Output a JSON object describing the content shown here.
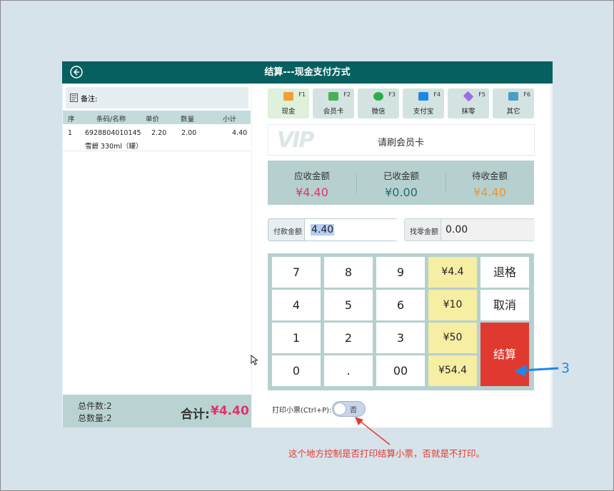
{
  "window": {
    "title": "结算---现金支付方式"
  },
  "left": {
    "memo_label": "备注:",
    "columns": [
      "序",
      "条码/名称",
      "单价",
      "数量",
      "小计"
    ],
    "items": [
      {
        "index": "1",
        "barcode": "6928804010145",
        "name": "雪碧 330ml（罐）",
        "price": "2.20",
        "qty": "2.00",
        "subtotal": "4.40"
      }
    ],
    "total_pieces": "总件数:2",
    "total_qty": "总数量:2",
    "total_label": "合计:",
    "total_value": "¥4.40"
  },
  "pay_methods": [
    {
      "label": "现金",
      "key": "F1",
      "icon": "cash-icon",
      "color": "#f29d38"
    },
    {
      "label": "会员卡",
      "key": "F2",
      "icon": "member-card-icon",
      "color": "#48b05a"
    },
    {
      "label": "微信",
      "key": "F3",
      "icon": "wechat-icon",
      "color": "#2aae4a"
    },
    {
      "label": "支付宝",
      "key": "F4",
      "icon": "alipay-icon",
      "color": "#1e88e5"
    },
    {
      "label": "抹零",
      "key": "F5",
      "icon": "diamond-icon",
      "color": "#9b6fe0"
    },
    {
      "label": "其它",
      "key": "F6",
      "icon": "cube-icon",
      "color": "#4a9fc4"
    }
  ],
  "vip": {
    "logo": "VIP",
    "prompt": "请刷会员卡"
  },
  "amounts": [
    {
      "label": "应收金额",
      "value": "¥4.40",
      "color": "#e0346b"
    },
    {
      "label": "已收金额",
      "value": "¥0.00",
      "color": "#1f6f6a"
    },
    {
      "label": "待收金额",
      "value": "¥4.40",
      "color": "#f0952b"
    }
  ],
  "payment": {
    "label": "付款金额",
    "value": "4.40"
  },
  "change": {
    "label": "找零金额",
    "value": "0.00"
  },
  "keypad": {
    "digits": [
      "7",
      "8",
      "9",
      "4",
      "5",
      "6",
      "1",
      "2",
      "3",
      "0",
      ".",
      "00"
    ],
    "quick_amounts": [
      "¥4.4",
      "¥10",
      "¥50",
      "¥54.4"
    ],
    "backspace": "退格",
    "cancel": "取消",
    "settle": "结算"
  },
  "print": {
    "label": "打印小票(Ctrl+P):",
    "state": "否"
  },
  "annotation": {
    "number": "3",
    "note": "这个地方控制是否打印结算小票，否就是不打印。"
  },
  "colors": {
    "header": "#06605f",
    "accent_red": "#e03a30",
    "annotation_red": "#e53935",
    "annotation_blue": "#1e88e5"
  }
}
